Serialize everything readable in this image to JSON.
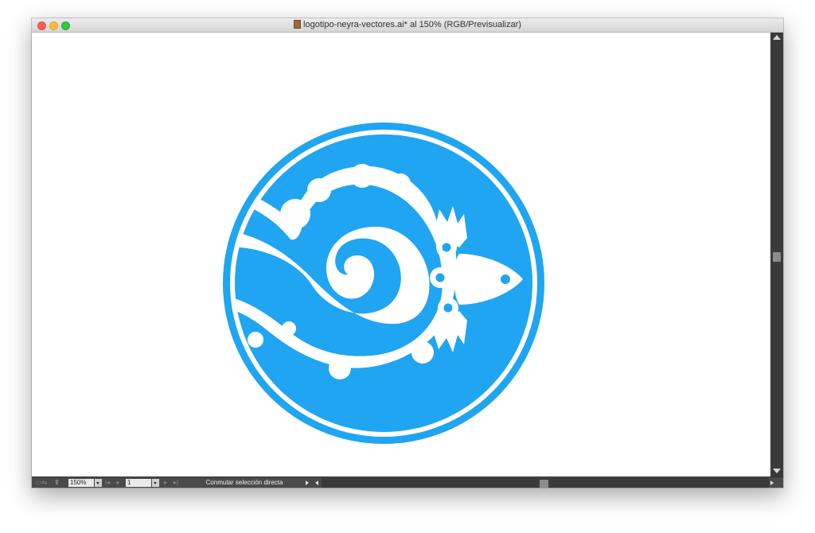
{
  "window": {
    "title": "logotipo-neyra-vectores.ai* al 150% (RGB/Previsualizar)",
    "file_icon": "illustrator-document-icon"
  },
  "statusbar": {
    "zoom": "150%",
    "page": "1",
    "status_text": "Conmutar selección directa"
  },
  "artwork": {
    "logo_color": "#1fa5f2",
    "background_color": "#ffffff"
  }
}
